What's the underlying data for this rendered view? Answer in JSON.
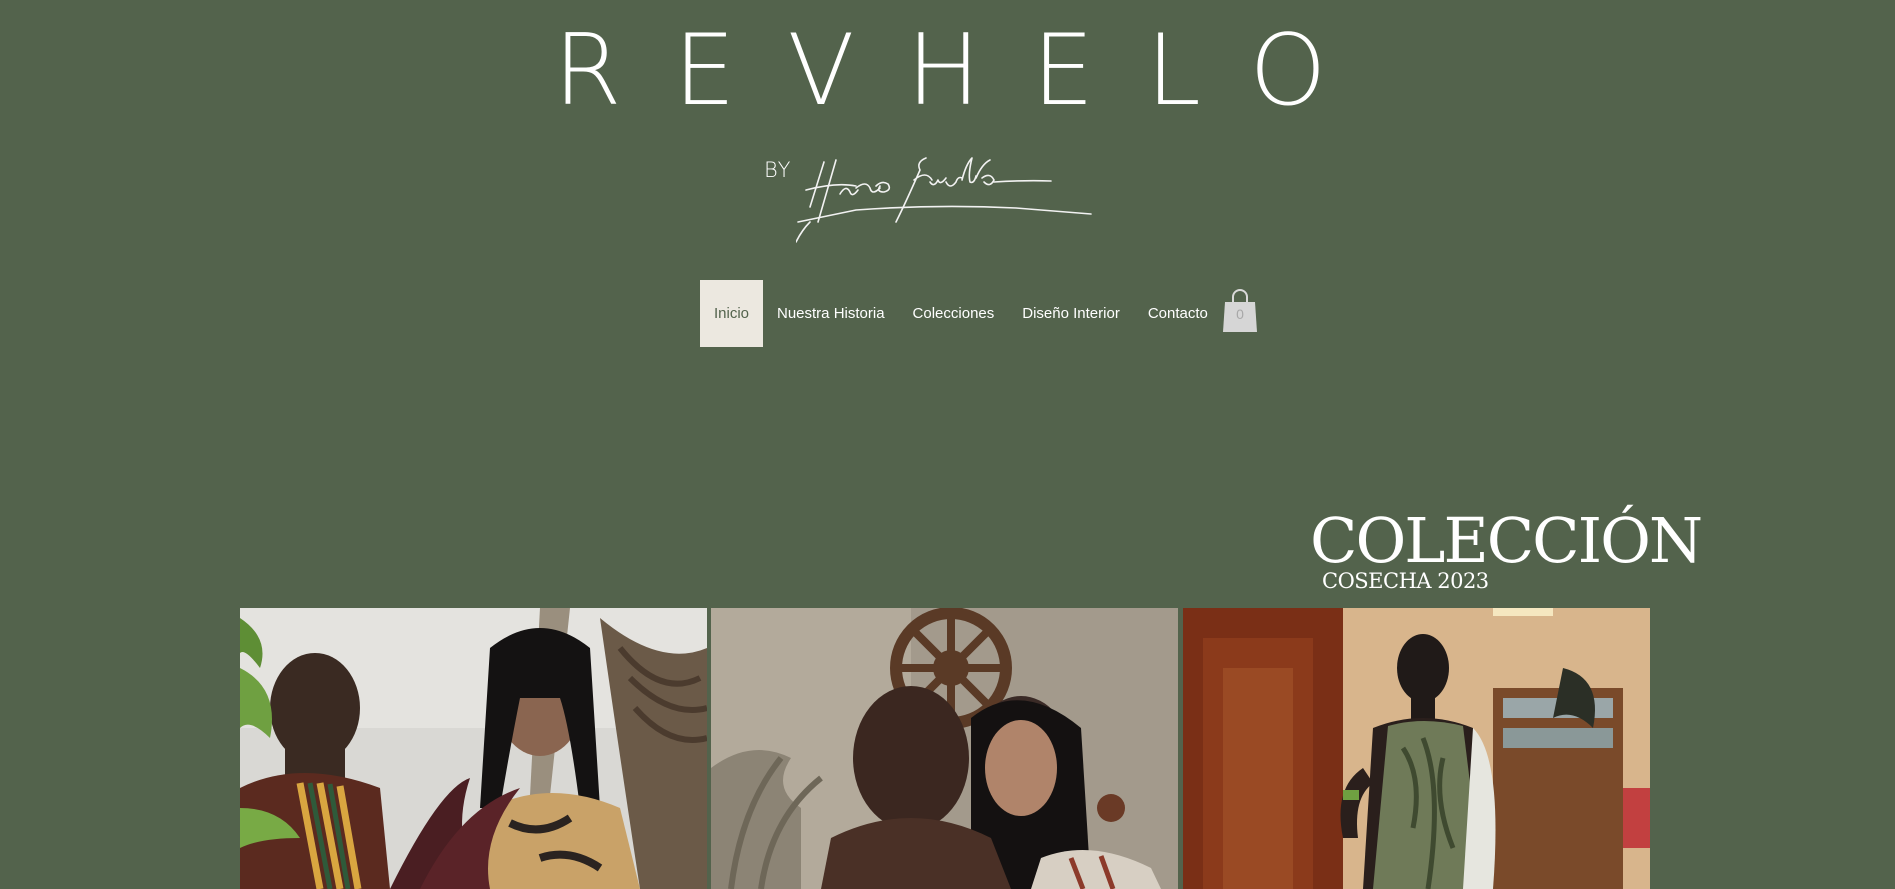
{
  "brand": {
    "title": "REVHELO",
    "by": "BY",
    "signature_text": "Hugo Rinaldo"
  },
  "nav": {
    "items": [
      {
        "label": "Inicio",
        "active": true
      },
      {
        "label": "Nuestra Historia",
        "active": false
      },
      {
        "label": "Colecciones",
        "active": false
      },
      {
        "label": "Diseño Interior",
        "active": false
      },
      {
        "label": "Contacto",
        "active": false
      }
    ],
    "cart_count": "0"
  },
  "hero": {
    "title": "COLECCIÓN",
    "subtitle": "COSECHA 2023"
  },
  "gallery": {
    "images": [
      {
        "icon": "photo-two-models-plants"
      },
      {
        "icon": "photo-couple-ship-wheel"
      },
      {
        "icon": "photo-model-silk-dress"
      }
    ]
  },
  "colors": {
    "background": "#53634c",
    "active_nav_bg": "#ece8e0",
    "text": "#ffffff"
  }
}
